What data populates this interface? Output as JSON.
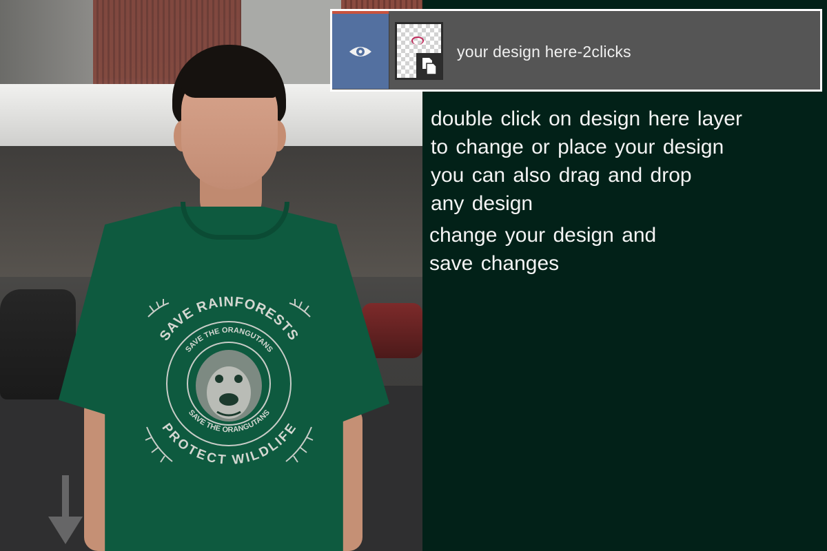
{
  "layer_panel": {
    "layer_name": "your design here-2clicks",
    "visibility_icon": "eye-icon",
    "thumbnail_badge_icon": "smart-object-icon",
    "colors": {
      "eye_cell": "#5370a0",
      "panel": "#555555",
      "accent": "#c9533e"
    }
  },
  "instructions": {
    "block1": [
      "double click on design here layer",
      "to change or place your design",
      "you can also drag and drop",
      "any design"
    ],
    "block2": [
      "change your design and",
      "save changes"
    ]
  },
  "shirt_print": {
    "top_arc": "SAVE RAINFORESTS",
    "inner_top_arc": "SAVE THE ORANGUTANS",
    "inner_bottom_arc": "SAVE THE ORANGUTANS",
    "bottom_arc": "PROTECT WILDLIFE"
  },
  "theme": {
    "background": "#022118",
    "shirt": "#0e5a3f",
    "text": "#f4f4f4"
  }
}
